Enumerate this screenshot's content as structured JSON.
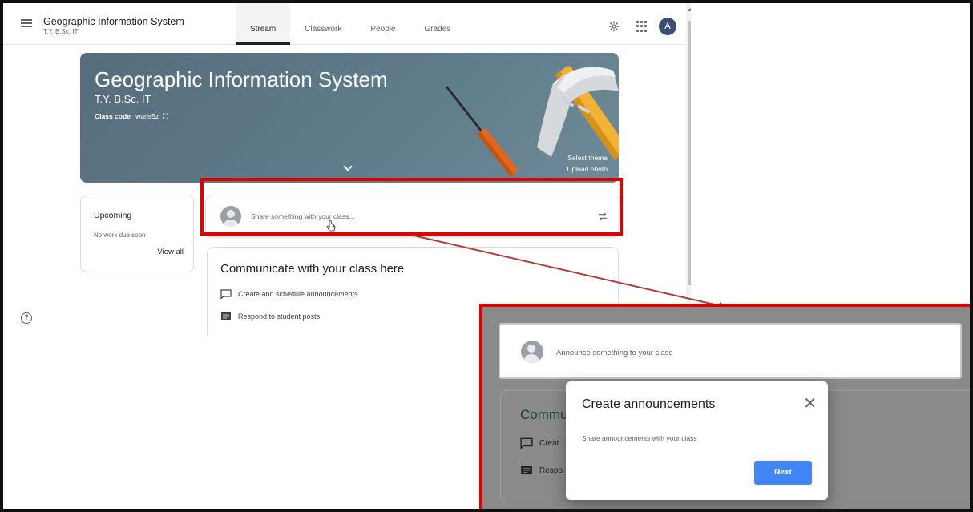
{
  "header": {
    "course_title": "Geographic Information System",
    "course_sub": "T.Y. B.Sc. IT",
    "tabs": [
      {
        "label": "Stream",
        "active": true
      },
      {
        "label": "Classwork",
        "active": false
      },
      {
        "label": "People",
        "active": false
      },
      {
        "label": "Grades",
        "active": false
      }
    ],
    "avatar_letter": "A",
    "icons": [
      "menu-icon",
      "gear-icon",
      "apps-grid-icon"
    ]
  },
  "banner": {
    "title": "Geographic Information System",
    "subtitle": "T.Y. B.Sc. IT",
    "class_code_label": "Class code",
    "class_code_value": "warls5z",
    "select_theme": "Select theme",
    "upload_photo": "Upload photo",
    "color": "#607d8b"
  },
  "upcoming": {
    "title": "Upcoming",
    "empty_text": "No work due soon",
    "view_all": "View all"
  },
  "share": {
    "placeholder": "Share something with your class..."
  },
  "communicate": {
    "title": "Communicate with your class here",
    "items": [
      {
        "label": "Create and schedule announcements",
        "icon": "chat-bubble-icon"
      },
      {
        "label": "Respond to student posts",
        "icon": "message-list-icon"
      }
    ]
  },
  "inset": {
    "placeholder": "Announce something to your class",
    "comm_title_partial": "Commu",
    "row1_partial": "Creat",
    "row2_partial": "Respo",
    "dialog": {
      "title": "Create announcements",
      "body": "Share announcements with your class",
      "next_label": "Next"
    }
  },
  "colors": {
    "highlight": "#e00000",
    "primary_button": "#4285f4",
    "avatar": "#3c4e73"
  }
}
